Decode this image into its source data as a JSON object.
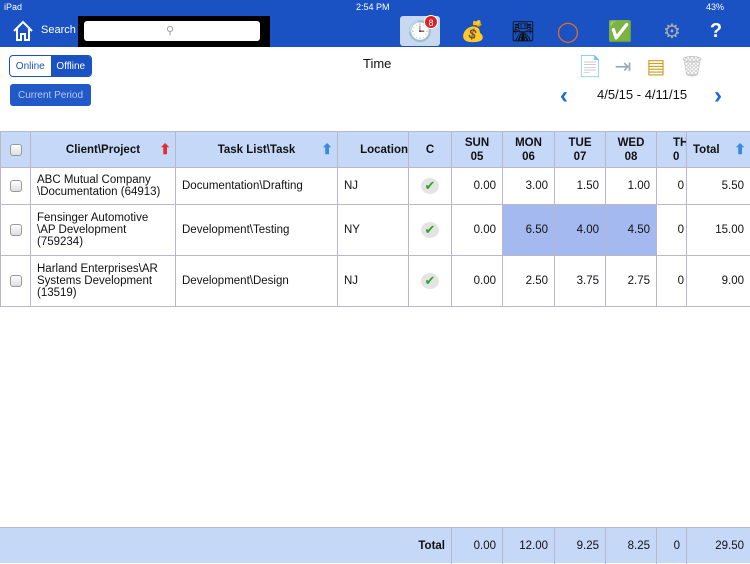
{
  "status": {
    "device": "iPad",
    "time": "2:54 PM",
    "battery": "43%"
  },
  "nav": {
    "search_label": "Search",
    "search_placeholder": "",
    "badge": "8",
    "icons": [
      "timesheet-icon",
      "expense-icon",
      "road-icon",
      "sync-icon",
      "approval-icon",
      "settings-icon",
      "help-icon"
    ]
  },
  "mode": {
    "online": "Online",
    "offline": "Offline",
    "selected": "Offline"
  },
  "current_period": "Current Period",
  "title": "Time",
  "range": "4/5/15 - 4/11/15",
  "table": {
    "headers": {
      "client": "Client\\Project",
      "task": "Task List\\Task",
      "location": "Location",
      "c": "C",
      "sun": [
        "SUN",
        "05"
      ],
      "mon": [
        "MON",
        "06"
      ],
      "tue": [
        "TUE",
        "07"
      ],
      "wed": [
        "WED",
        "08"
      ],
      "thu": [
        "TH",
        "0"
      ],
      "total": "Total"
    },
    "rows": [
      {
        "client": "ABC Mutual Company \\Documentation (64913)",
        "task": "Documentation\\Drafting",
        "location": "NJ",
        "sun": "0.00",
        "mon": "3.00",
        "tue": "1.50",
        "wed": "1.00",
        "thu": "0",
        "total": "5.50"
      },
      {
        "client": "Fensinger Automotive \\AP Development (759234)",
        "task": "Development\\Testing",
        "location": "NY",
        "sun": "0.00",
        "mon": "6.50",
        "tue": "4.00",
        "wed": "4.50",
        "thu": "0",
        "total": "15.00"
      },
      {
        "client": "Harland Enterprises\\AR Systems Development (13519)",
        "task": "Development\\Design",
        "location": "NJ",
        "sun": "0.00",
        "mon": "2.50",
        "tue": "3.75",
        "wed": "2.75",
        "thu": "0",
        "total": "9.00"
      }
    ]
  },
  "footer": {
    "label": "Total",
    "sun": "0.00",
    "mon": "12.00",
    "tue": "9.25",
    "wed": "8.25",
    "thu": "0",
    "total": "29.50"
  },
  "colors": {
    "brand": "#1a52c4",
    "header": "#c6d8f8",
    "highlight": "#a4b9ef"
  }
}
